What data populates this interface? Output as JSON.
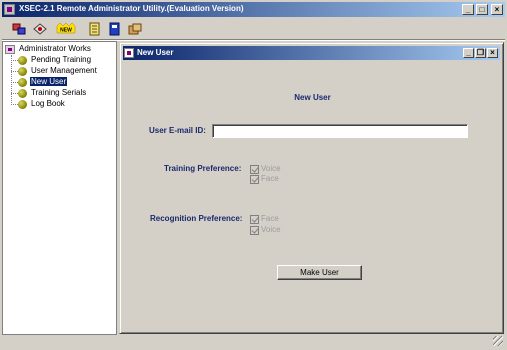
{
  "window": {
    "title": "XSEC-2.1 Remote Administrator Utility.(Evaluation Version)",
    "controls": {
      "minimize": "_",
      "maximize": "□",
      "close": "×"
    }
  },
  "toolbar": {
    "icons": [
      "users-icon",
      "network-icon",
      "new-icon",
      "document-icon",
      "book-icon",
      "export-icon"
    ],
    "new_label": "NEW"
  },
  "tree": {
    "root": "Administrator Works",
    "items": [
      {
        "label": "Pending Training"
      },
      {
        "label": "User Management"
      },
      {
        "label": "New User",
        "selected": true
      },
      {
        "label": "Training Serials"
      },
      {
        "label": "Log Book"
      }
    ]
  },
  "internal_frame": {
    "title": "New User",
    "controls": {
      "minimize": "_",
      "restore": "❐",
      "close": "×"
    }
  },
  "form": {
    "heading": "New User",
    "email_label": "User E-mail ID:",
    "email_value": "",
    "training_label": "Training Preference:",
    "training_options": [
      {
        "label": "Voice",
        "checked": true,
        "disabled": true
      },
      {
        "label": "Face",
        "checked": true,
        "disabled": true
      }
    ],
    "recognition_label": "Recognition Preference:",
    "recognition_options": [
      {
        "label": "Face",
        "checked": true,
        "disabled": true
      },
      {
        "label": "Voice",
        "checked": true,
        "disabled": true
      }
    ],
    "submit_label": "Make User"
  },
  "colors": {
    "titlebar_start": "#0a246a",
    "titlebar_end": "#a6caf0",
    "label_blue": "#1a2a6e",
    "selection": "#0a246a"
  }
}
